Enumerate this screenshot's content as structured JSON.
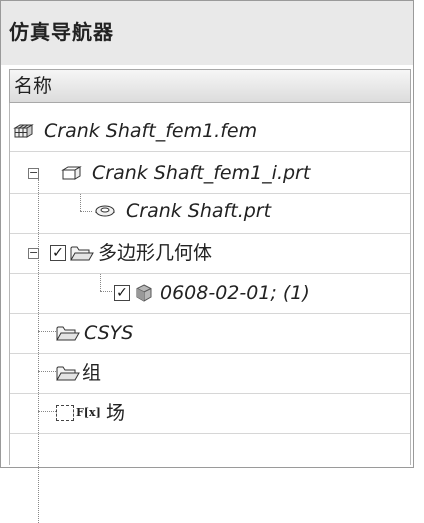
{
  "panel": {
    "title": "仿真导航器",
    "column_header": "名称"
  },
  "tree": [
    {
      "label": "Crank Shaft_fem1.fem",
      "icon": "fem-mesh-icon"
    },
    {
      "label": "Crank Shaft_fem1_i.prt",
      "icon": "idealized-part-icon",
      "expander": "−"
    },
    {
      "label": "Crank Shaft.prt",
      "icon": "part-icon"
    },
    {
      "label": "多边形几何体",
      "icon": "folder-icon",
      "checked": "✓",
      "expander": "−"
    },
    {
      "label": "0608-02-01; (1)",
      "icon": "solid-body-icon",
      "checked": "✓"
    },
    {
      "label": "CSYS",
      "icon": "folder-icon"
    },
    {
      "label": "组",
      "icon": "folder-icon"
    },
    {
      "label": "场",
      "icon": "field-icon",
      "fx": "F[x]"
    }
  ]
}
